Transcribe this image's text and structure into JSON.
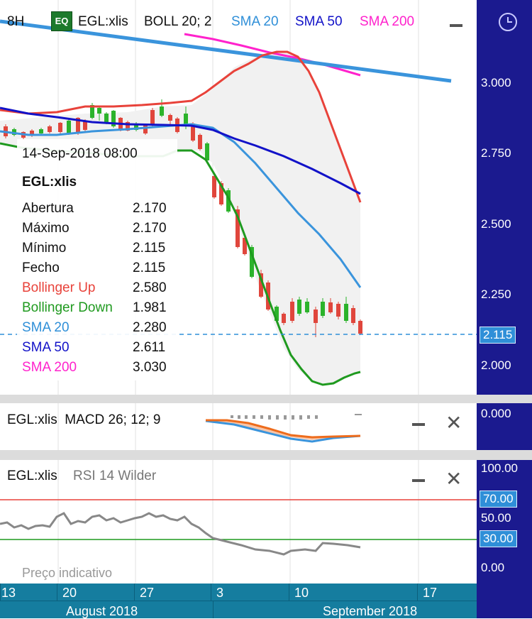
{
  "header": {
    "interval": "8H",
    "badge": "EQ",
    "symbol": "EGL:xlis",
    "boll": "BOLL 20; 2",
    "sma20": "SMA 20",
    "sma50": "SMA 50",
    "sma200": "SMA 200"
  },
  "price_axis": {
    "labels": [
      "3.000",
      "2.750",
      "2.500",
      "2.250",
      "2.000"
    ],
    "current": "2.115"
  },
  "tooltip": {
    "datetime": "14-Sep-2018 08:00",
    "symbol": "EGL:xlis",
    "rows": [
      {
        "label": "Abertura",
        "value": "2.170",
        "color": "#111111"
      },
      {
        "label": "Máximo",
        "value": "2.170",
        "color": "#111111"
      },
      {
        "label": "Mínimo",
        "value": "2.115",
        "color": "#111111"
      },
      {
        "label": "Fecho",
        "value": "2.115",
        "color": "#111111"
      },
      {
        "label": "Bollinger Up",
        "value": "2.580",
        "color": "#e8423a"
      },
      {
        "label": "Bollinger Down",
        "value": "1.981",
        "color": "#1f9a1f"
      },
      {
        "label": "SMA 20",
        "value": "2.280",
        "color": "#2f8fd8"
      },
      {
        "label": "SMA 50",
        "value": "2.611",
        "color": "#1212c8"
      },
      {
        "label": "SMA 200",
        "value": "3.030",
        "color": "#ff22cc"
      }
    ]
  },
  "macd": {
    "title": "EGL:xlis  MACD 26; 12; 9",
    "axis": "0.000"
  },
  "rsi": {
    "symbol": "EGL:xlis",
    "title": "RSI 14 Wilder",
    "labels": [
      "100.00",
      "70.00",
      "50.00",
      "30.00",
      "0.00"
    ],
    "watermark": "Preço indicativo"
  },
  "dates": {
    "days": [
      "13",
      "20",
      "27",
      "3",
      "10",
      "17"
    ],
    "months": [
      "August 2018",
      "September 2018"
    ]
  },
  "colors": {
    "axis": "#1b1a8f",
    "boll_up": "#e8423a",
    "boll_down": "#1f9a1f",
    "sma20": "#2f8fd8",
    "sma50": "#1212c8",
    "sma200": "#ff22cc",
    "up": "#2bb32b",
    "down": "#e0463c"
  }
}
